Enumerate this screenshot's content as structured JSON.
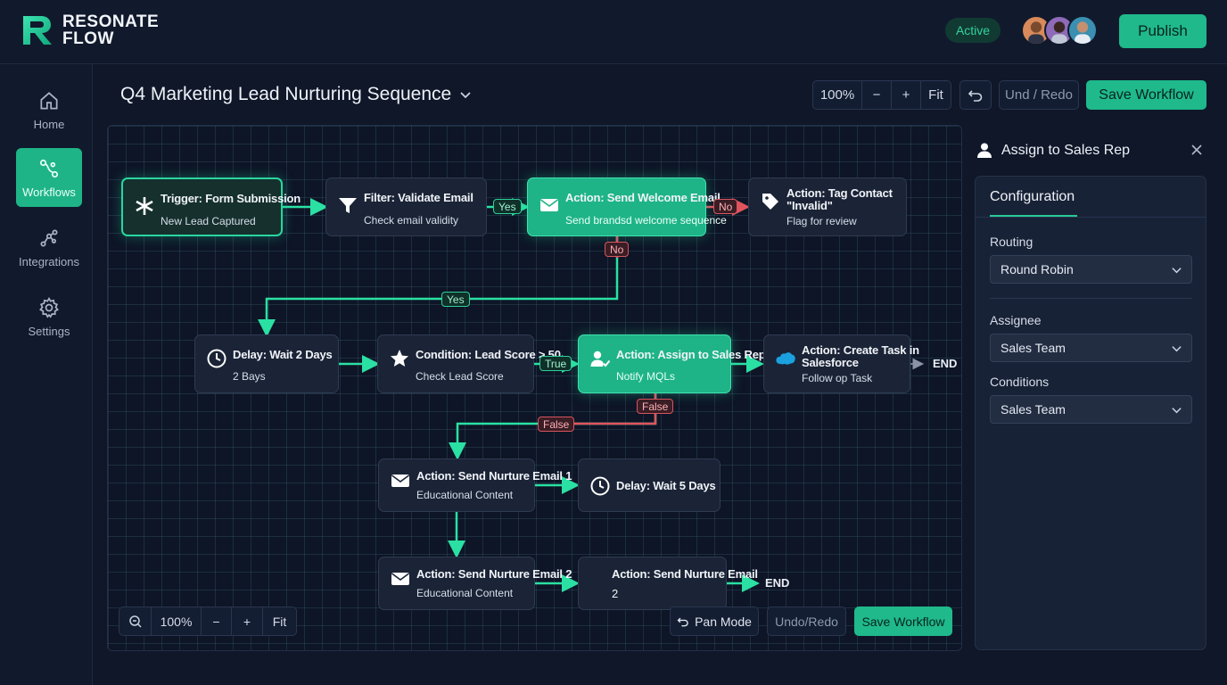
{
  "app": {
    "name_line1": "RESONATE",
    "name_line2": "FLOW"
  },
  "header": {
    "status": "Active",
    "publish_label": "Publish"
  },
  "sidebar": {
    "items": [
      {
        "label": "Home",
        "icon": "home-icon"
      },
      {
        "label": "Workflows",
        "icon": "workflows-icon",
        "active": true
      },
      {
        "label": "Integrations",
        "icon": "integrations-icon"
      },
      {
        "label": "Settings",
        "icon": "gear-icon"
      }
    ]
  },
  "workflow": {
    "title": "Q4 Marketing Lead Nurturing Sequence",
    "zoom": "100%",
    "zoom_out": "−",
    "zoom_in": "+",
    "fit": "Fit",
    "undo_redo": "Und / Redo",
    "save_label": "Save Workflow"
  },
  "nodes": {
    "trigger": {
      "title": "Trigger: Form Submission",
      "subtitle": "New Lead Captured"
    },
    "filter": {
      "title": "Filter: Validate Email",
      "subtitle": "Check email validity"
    },
    "welcome": {
      "title": "Action: Send Welcome Email",
      "subtitle": "Send brandsd welcome sequence"
    },
    "tag": {
      "title": "Action: Tag Contact",
      "title2": "\"Invalid\"",
      "subtitle": "Flag for review"
    },
    "delay2": {
      "title": "Delay: Wait 2 Days",
      "subtitle": "2 Bays"
    },
    "condition": {
      "title": "Condition: Lead Score > 50",
      "subtitle": "Check Lead Score"
    },
    "assign": {
      "title": "Action: Assign to Sales Rep",
      "subtitle": "Notify MQLs"
    },
    "task": {
      "title": "Action: Create Task in",
      "title2": "Salesforce",
      "subtitle": "Follow op Task"
    },
    "nurture1": {
      "title": "Action: Send Nurture Email 1",
      "subtitle": "Educational Content"
    },
    "delay5": {
      "title": "Delay: Wait 5 Days"
    },
    "nurture2": {
      "title": "Action: Send Nurture Email 2",
      "subtitle": "Educational Content"
    },
    "nurture_plain": {
      "title": "Action: Send Nurture Email",
      "subtitle": "2"
    }
  },
  "edge_labels": {
    "yes1": "Yes",
    "no1": "No",
    "no2": "No",
    "yes2": "Yes",
    "true1": "True",
    "false1": "False",
    "false2": "False"
  },
  "end_labels": {
    "end1": "END",
    "end2": "END"
  },
  "canvas_controls": {
    "zoom": "100%",
    "zoom_out": "−",
    "zoom_in": "+",
    "fit": "Fit",
    "pan_mode": "Pan Mode",
    "undo_redo": "Undo/Redo",
    "save_label": "Save Workflow"
  },
  "panel": {
    "title": "Assign to Sales Rep",
    "tab": "Configuration",
    "routing_label": "Routing",
    "routing_value": "Round Robin",
    "assignee_label": "Assignee",
    "assignee_value": "Sales Team",
    "conditions_label": "Conditions",
    "conditions_value": "Sales Team"
  },
  "colors": {
    "accent": "#1fb98c",
    "error": "#d8545e",
    "background": "#0f1729"
  }
}
